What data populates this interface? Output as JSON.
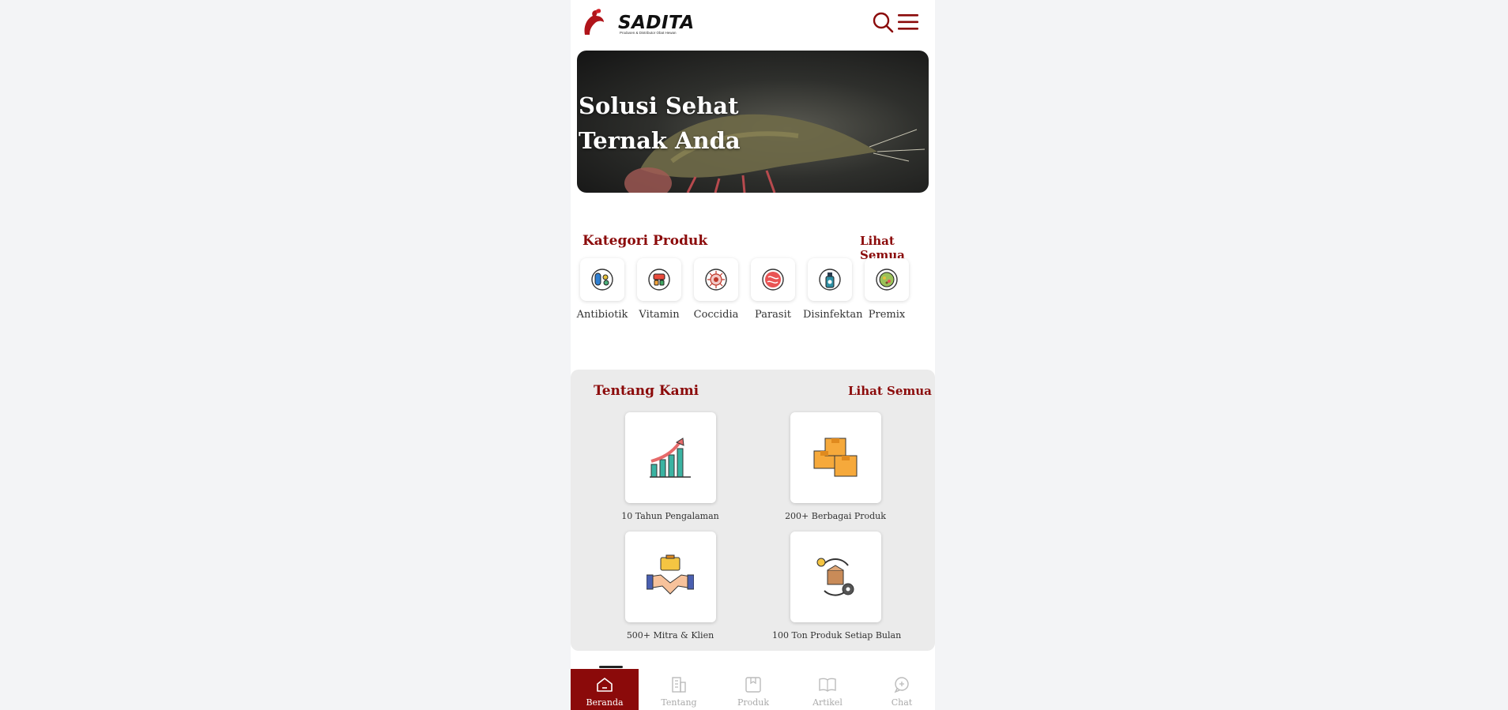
{
  "header": {
    "brand": "SADITA",
    "tagline": "Produsen & Distributor Obat Hewan"
  },
  "hero": {
    "title": "Solusi Sehat Ternak Anda"
  },
  "categories": {
    "title": "Kategori Produk",
    "see_all": "Lihat Semua",
    "items": [
      {
        "label": "Antibiotik",
        "icon": "antibiotic-icon"
      },
      {
        "label": "Vitamin",
        "icon": "vitamin-icon"
      },
      {
        "label": "Coccidia",
        "icon": "coccidia-icon"
      },
      {
        "label": "Parasit",
        "icon": "parasite-icon"
      },
      {
        "label": "Disinfektan",
        "icon": "disinfectant-icon"
      },
      {
        "label": "Premix",
        "icon": "premix-icon"
      }
    ]
  },
  "about": {
    "title": "Tentang Kami",
    "see_all": "Lihat Semua",
    "stats": [
      {
        "label": "10 Tahun Pengalaman",
        "icon": "growth-chart-icon"
      },
      {
        "label": "200+ Berbagai Produk",
        "icon": "boxes-icon"
      },
      {
        "label": "500+ Mitra & Klien",
        "icon": "handshake-icon"
      },
      {
        "label": "100 Ton Produk Setiap Bulan",
        "icon": "production-cycle-icon"
      }
    ]
  },
  "nav": {
    "items": [
      {
        "label": "Beranda",
        "icon": "home-icon",
        "active": true
      },
      {
        "label": "Tentang",
        "icon": "building-icon",
        "active": false
      },
      {
        "label": "Produk",
        "icon": "product-icon",
        "active": false
      },
      {
        "label": "Artikel",
        "icon": "book-icon",
        "active": false
      },
      {
        "label": "Chat",
        "icon": "chat-icon",
        "active": false
      }
    ]
  },
  "colors": {
    "brand": "#8b0a0a",
    "background": "#f3f4f6",
    "card_section": "#ebebeb"
  }
}
